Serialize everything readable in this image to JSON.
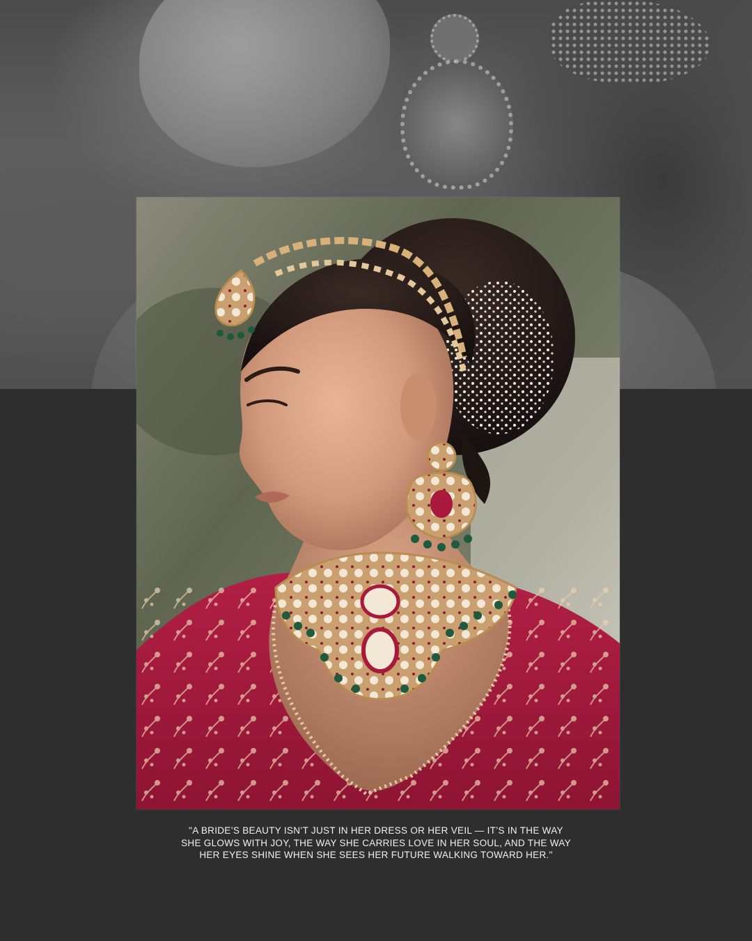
{
  "quote": {
    "text": "\"A BRIDE’S BEAUTY ISN’T JUST IN HER DRESS OR HER VEIL — IT’S IN THE WAY SHE GLOWS WITH JOY, THE WAY SHE CARRIES LOVE IN HER SOUL, AND THE WAY HER EYES SHINE WHEN SHE SEES HER FUTURE WALKING TOWARD HER.\""
  },
  "colors": {
    "background": "#2e2e2e",
    "text": "#f1f1f1",
    "dress": "#a8193c",
    "gold": "#d8b07a",
    "emerald": "#1f5a3e"
  }
}
